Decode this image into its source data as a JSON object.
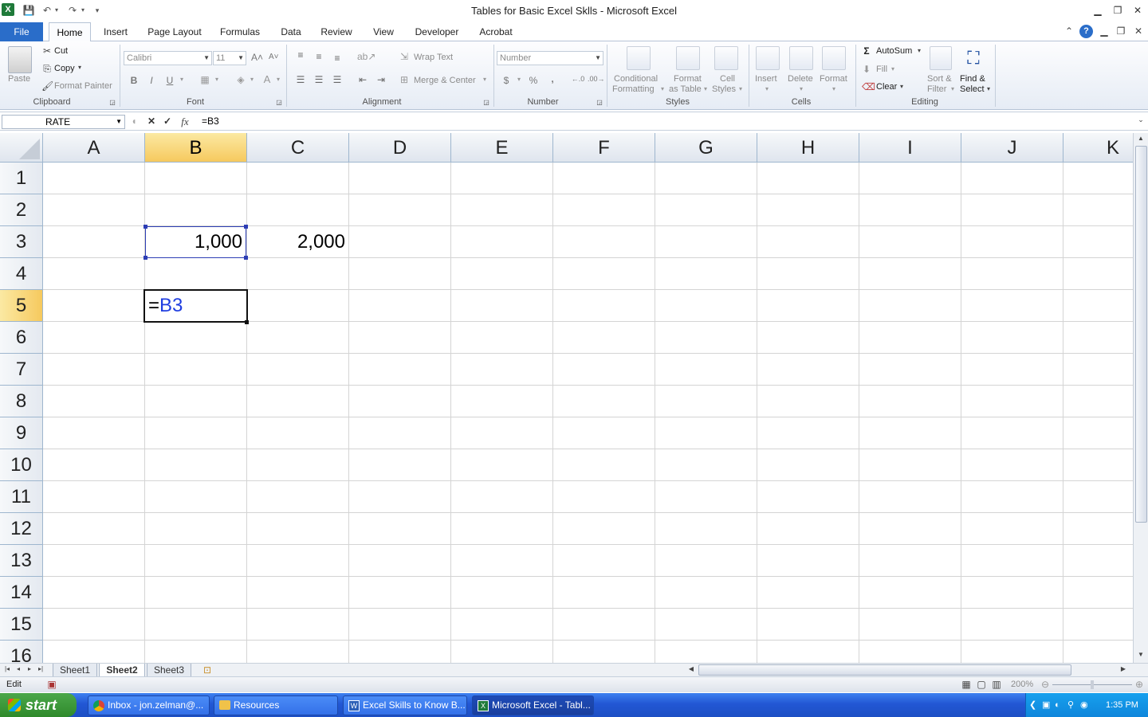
{
  "window": {
    "title": "Tables for Basic Excel Sklls  -  Microsoft Excel"
  },
  "tabs": [
    "File",
    "Home",
    "Insert",
    "Page Layout",
    "Formulas",
    "Data",
    "Review",
    "View",
    "Developer",
    "Acrobat"
  ],
  "clipboard": {
    "paste": "Paste",
    "cut": "Cut",
    "copy": "Copy",
    "format_painter": "Format Painter",
    "label": "Clipboard"
  },
  "font": {
    "name": "Calibri",
    "size": "11",
    "bold": "B",
    "italic": "I",
    "underline": "U",
    "color_a": "A",
    "label": "Font"
  },
  "alignment": {
    "wrap": "Wrap Text",
    "merge": "Merge & Center",
    "label": "Alignment"
  },
  "number": {
    "format": "Number",
    "currency": "$",
    "percent": "%",
    "comma": ",",
    "inc": ".0 .00",
    "dec": ".00 .0",
    "label": "Number"
  },
  "styles": {
    "conditional_1": "Conditional",
    "conditional_2": "Formatting",
    "format_table_1": "Format",
    "format_table_2": "as Table",
    "cell_styles_1": "Cell",
    "cell_styles_2": "Styles",
    "label": "Styles"
  },
  "cells": {
    "insert": "Insert",
    "delete": "Delete",
    "format": "Format",
    "label": "Cells"
  },
  "editing": {
    "autosum": "AutoSum",
    "fill": "Fill",
    "clear": "Clear",
    "sort_1": "Sort &",
    "sort_2": "Filter",
    "find_1": "Find &",
    "find_2": "Select",
    "label": "Editing"
  },
  "formula_bar": {
    "name_box": "RATE",
    "formula": "=B3",
    "fx": "fx"
  },
  "columns": [
    "A",
    "B",
    "C",
    "D",
    "E",
    "F",
    "G",
    "H",
    "I",
    "J",
    "K"
  ],
  "rows": [
    "1",
    "2",
    "3",
    "4",
    "5",
    "6",
    "7",
    "8",
    "9",
    "10",
    "11",
    "12",
    "13",
    "14",
    "15",
    "16"
  ],
  "cells_data": {
    "B3": "1,000",
    "C3": "2,000",
    "B5_eq": "=",
    "B5_ref": "B3"
  },
  "sheets": [
    "Sheet1",
    "Sheet2",
    "Sheet3"
  ],
  "status": {
    "mode": "Edit",
    "zoom": "200%"
  },
  "taskbar": {
    "start": "start",
    "items": [
      "Inbox - jon.zelman@...",
      "Resources",
      "Excel Skills to Know B...",
      "Microsoft Excel - Tabl..."
    ],
    "time": "1:35 PM"
  },
  "colors": {
    "accent": "#2a6dc9",
    "selected_header": "#f6c95e",
    "ref_blue": "#1f3de0",
    "range_border": "#2d3eb5"
  }
}
